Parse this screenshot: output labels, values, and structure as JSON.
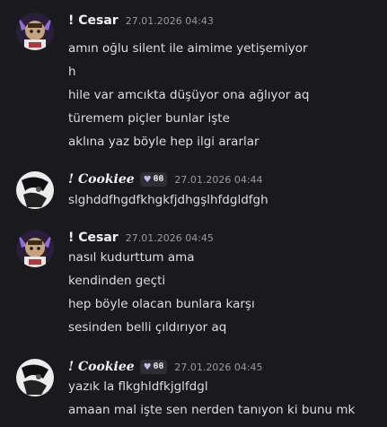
{
  "messages": [
    {
      "author": "! Cesar",
      "timestamp": "27.01.2026 04:43",
      "avatar": "cesar-avatar",
      "lines": [
        "amın oğlu silent ile aimime yetişemiyor",
        "h",
        "hile var amcıkta düşüyor ona ağlıyor aq",
        "türemem piçler bunlar işte",
        "aklına yaz böyle hep ilgi ararlar"
      ]
    },
    {
      "author": "! Cookiee",
      "timestamp": "27.01.2026 04:44",
      "avatar": "cookiee-avatar",
      "tag": "ϐϐ",
      "lines": [
        "slghddfhgdfkhgkfjdhgşlhfdgldfgh"
      ]
    },
    {
      "author": "! Cesar",
      "timestamp": "27.01.2026 04:45",
      "avatar": "cesar-avatar",
      "lines": [
        "nasıl kudurttum ama",
        "kendinden geçti",
        "hep böyle olacan bunlara karşı",
        "sesinden belli çıldırıyor aq"
      ]
    },
    {
      "author": "! Cookiee",
      "timestamp": "27.01.2026 04:45",
      "avatar": "cookiee-avatar",
      "tag": "ϐϐ",
      "lines": [
        "yazık la flkghldfkjglfdgl",
        "amaan mal işte sen nerden tanıyon ki bunu mk"
      ]
    }
  ]
}
